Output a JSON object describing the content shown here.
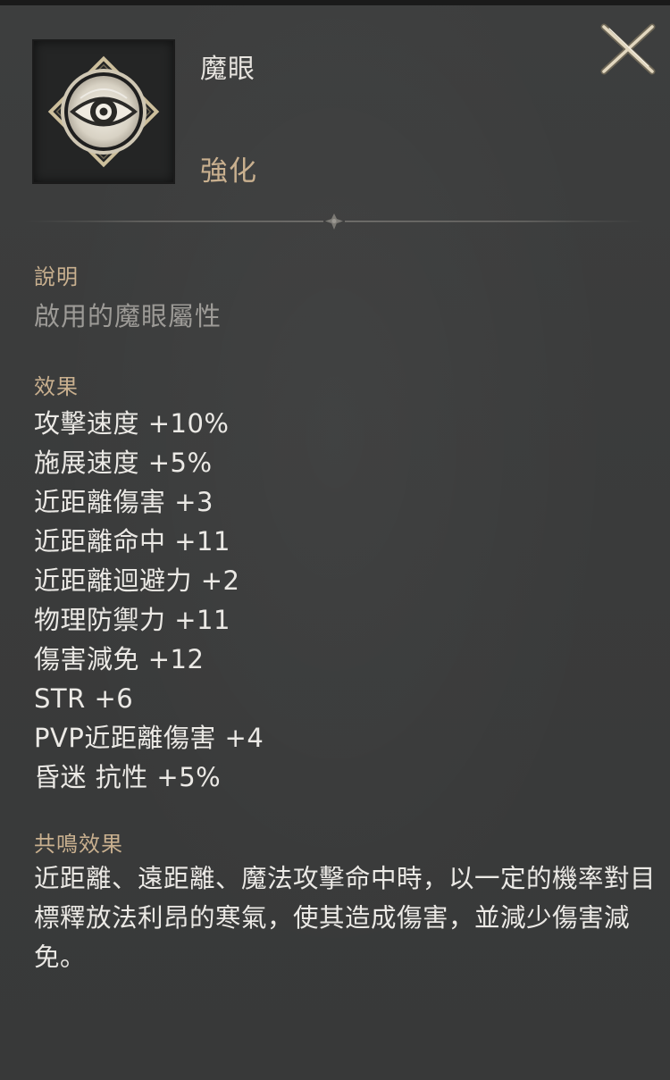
{
  "item": {
    "name": "魔眼",
    "type": "強化",
    "icon": "demon-eye-icon"
  },
  "description": {
    "label": "說明",
    "text": "啟用的魔眼屬性"
  },
  "effects": {
    "label": "效果",
    "items": [
      "攻擊速度 +10%",
      "施展速度 +5%",
      "近距離傷害 +3",
      "近距離命中 +11",
      "近距離迴避力 +2",
      "物理防禦力 +11",
      "傷害減免 +12",
      "STR +6",
      "PVP近距離傷害 +4",
      "昏迷 抗性 +5%"
    ]
  },
  "resonance": {
    "label": "共鳴效果",
    "text": "近距離、遠距離、魔法攻擊命中時，以一定的機率對目標釋放法利昂的寒氣，使其造成傷害，並減少傷害減免。"
  },
  "controls": {
    "close_icon": "close-icon"
  },
  "colors": {
    "panel_bg": "#3a3b3b",
    "label_gold": "#c9b08f",
    "text_light": "#ebe9e5",
    "text_muted": "#9d9b97"
  }
}
